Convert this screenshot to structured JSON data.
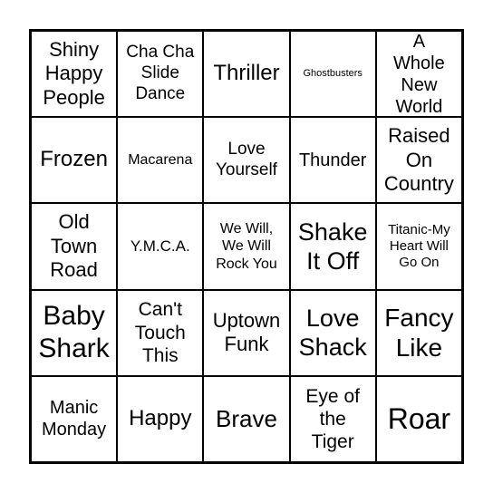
{
  "cells": [
    "Shiny Happy People",
    "Cha Cha Slide Dance",
    "Thriller",
    "Ghostbusters",
    "A Whole New World",
    "Frozen",
    "Macarena",
    "Love Yourself",
    "Thunder",
    "Raised On Country",
    "Old Town Road",
    "Y.M.C.A.",
    "We Will, We Will Rock You",
    "Shake It Off",
    "Titanic-My Heart Will Go On",
    "Baby Shark",
    "Can't Touch This",
    "Uptown Funk",
    "Love Shack",
    "Fancy Like",
    "Manic Monday",
    "Happy",
    "Brave",
    "Eye of the Tiger",
    "Roar"
  ]
}
